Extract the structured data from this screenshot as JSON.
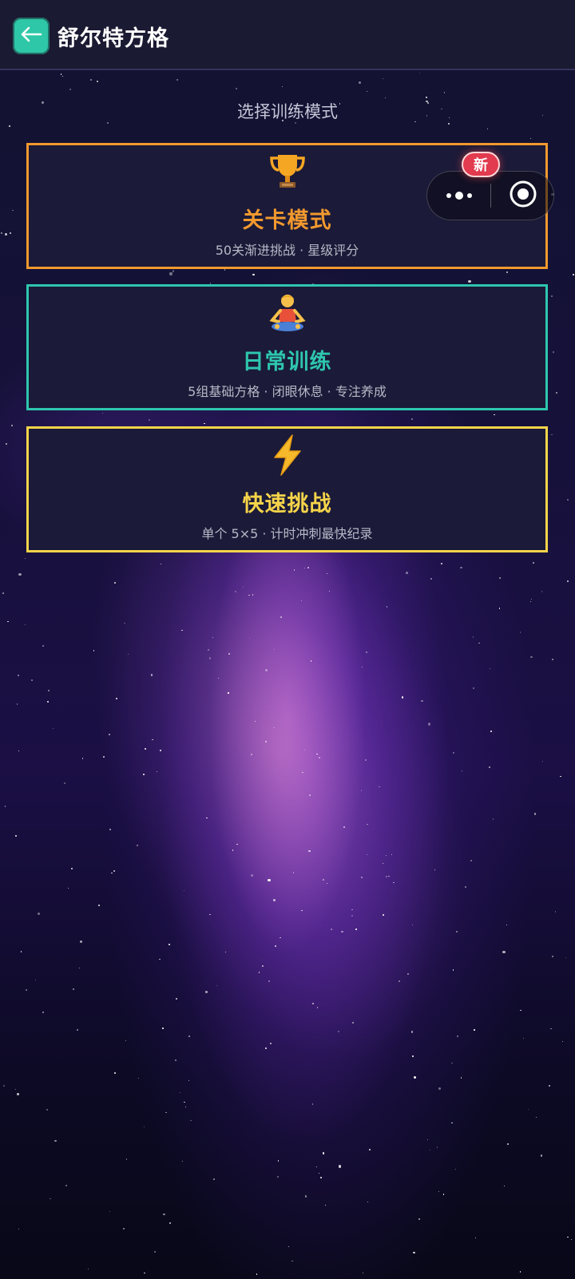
{
  "header": {
    "title": "舒尔特方格"
  },
  "subtitle": "选择训练模式",
  "badge_new": "新",
  "colors": {
    "accent_teal": "#2ec7a7",
    "level_orange": "#f2992e",
    "daily_teal": "#2ec6ae",
    "quick_yellow": "#f6d44a",
    "card_bg": "#1b1a38"
  },
  "modes": [
    {
      "icon": "trophy-icon",
      "title": "关卡模式",
      "desc": "50关渐进挑战 · 星级评分"
    },
    {
      "icon": "meditation-icon",
      "title": "日常训练",
      "desc": "5组基础方格 · 闭眼休息 · 专注养成"
    },
    {
      "icon": "lightning-icon",
      "title": "快速挑战",
      "desc": "单个 5×5 · 计时冲刺最快纪录"
    }
  ]
}
